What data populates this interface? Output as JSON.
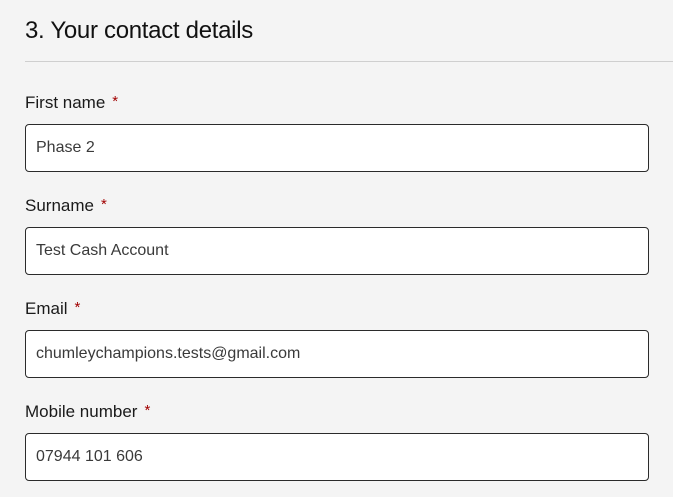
{
  "section": {
    "title": "3. Your contact details"
  },
  "fields": {
    "first_name": {
      "label": "First name",
      "required_marker": "*",
      "value": "Phase 2"
    },
    "surname": {
      "label": "Surname",
      "required_marker": "*",
      "value": "Test Cash Account"
    },
    "email": {
      "label": "Email",
      "required_marker": "*",
      "value": "chumleychampions.tests@gmail.com"
    },
    "mobile": {
      "label": "Mobile number",
      "required_marker": "*",
      "value": "07944 101 606"
    }
  },
  "colors": {
    "background": "#f4f4f4",
    "input_background": "#ffffff",
    "input_border": "#2b2b2b",
    "required_marker": "#a10000",
    "divider": "#cfcfcf"
  }
}
